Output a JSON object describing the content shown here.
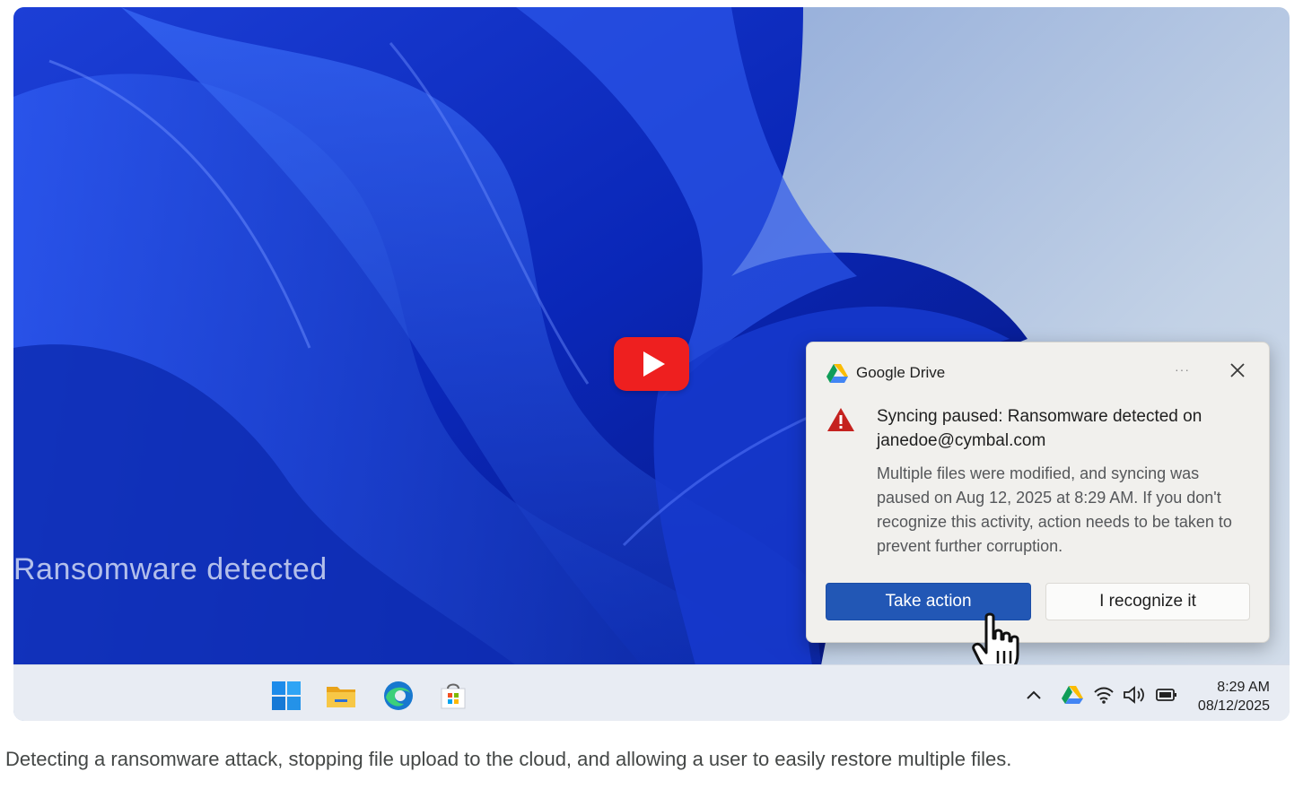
{
  "video": {
    "overlay_caption": "Ransomware detected",
    "play_button": {
      "icon": "youtube-play-icon",
      "color": "#ee1f1f"
    }
  },
  "notification": {
    "app_name": "Google Drive",
    "more_label": "···",
    "title": "Syncing paused: Ransomware detected on janedoe@cymbal.com",
    "body": "Multiple files were modified, and syncing was paused on Aug 12, 2025 at 8:29 AM. If you don't recognize this activity, action needs to be taken to prevent further corruption.",
    "primary_button": "Take action",
    "secondary_button": "I recognize it",
    "warning_color": "#c5221f",
    "accent_color": "#2257b5"
  },
  "taskbar": {
    "pinned": [
      "windows-start-icon",
      "file-explorer-icon",
      "edge-browser-icon",
      "microsoft-store-icon"
    ],
    "tray": [
      "chevron-up-icon",
      "google-drive-icon",
      "wifi-icon",
      "volume-icon",
      "battery-icon"
    ],
    "time": "8:29 AM",
    "date": "08/12/2025"
  },
  "caption": "Detecting a ransomware attack, stopping file upload to the cloud, and allowing a user to easily restore multiple files."
}
